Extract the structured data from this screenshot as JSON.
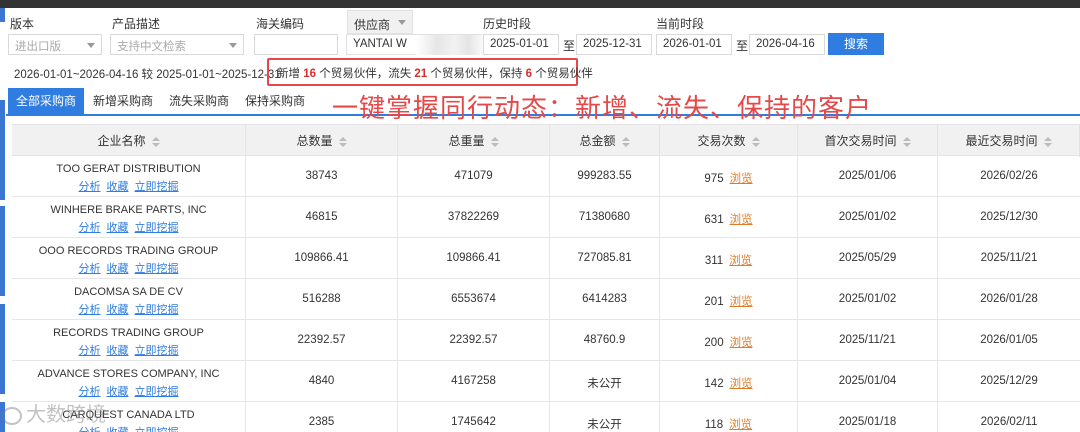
{
  "filters": {
    "version": {
      "label": "版本",
      "placeholder": "进出口版"
    },
    "product": {
      "label": "产品描述",
      "placeholder": "支持中文检索"
    },
    "hscode": {
      "label": "海关编码",
      "value": ""
    },
    "supplier": {
      "label": "供应商",
      "value": "YANTAI W"
    },
    "history": {
      "label": "历史时段",
      "start": "2025-01-01",
      "sep": "至",
      "end": "2025-12-31"
    },
    "current": {
      "label": "当前时段",
      "start": "2026-01-01",
      "sep": "至",
      "end": "2026-04-16"
    },
    "search_label": "搜索"
  },
  "summary": {
    "compare_text": "2026-01-01~2026-04-16 较 2025-01-01~2025-12-31",
    "new_prefix": "新增",
    "new_count": "16",
    "new_suffix": "个贸易伙伴，流失",
    "lost_count": "21",
    "lost_suffix": "个贸易伙伴，保持",
    "kept_count": "6",
    "kept_suffix": "个贸易伙伴"
  },
  "tabs": [
    "全部采购商",
    "新增采购商",
    "流失采购商",
    "保持采购商"
  ],
  "slogan": "一键掌握同行动态：新增、流失、保持的客户",
  "table": {
    "columns": [
      "企业名称",
      "总数量",
      "总重量",
      "总金额",
      "交易次数",
      "首次交易时间",
      "最近交易时间"
    ],
    "link_labels": {
      "analyze": "分析",
      "favorite": "收藏",
      "mine": "立即挖掘",
      "browse": "浏览"
    },
    "rows": [
      {
        "name": "TOO GERAT DISTRIBUTION",
        "qty": "38743",
        "weight": "471079",
        "amount": "999283.55",
        "trades": "975",
        "first": "2025/01/06",
        "last": "2026/02/26"
      },
      {
        "name": "WINHERE BRAKE PARTS, INC",
        "qty": "46815",
        "weight": "37822269",
        "amount": "71380680",
        "trades": "631",
        "first": "2025/01/02",
        "last": "2025/12/30"
      },
      {
        "name": "OOO RECORDS TRADING GROUP",
        "qty": "109866.41",
        "weight": "109866.41",
        "amount": "727085.81",
        "trades": "311",
        "first": "2025/05/29",
        "last": "2025/11/21"
      },
      {
        "name": "DACOMSA SA DE CV",
        "qty": "516288",
        "weight": "6553674",
        "amount": "6414283",
        "trades": "201",
        "first": "2025/01/02",
        "last": "2026/01/28"
      },
      {
        "name": "RECORDS TRADING GROUP",
        "qty": "22392.57",
        "weight": "22392.57",
        "amount": "48760.9",
        "trades": "200",
        "first": "2025/11/21",
        "last": "2026/01/05"
      },
      {
        "name": "ADVANCE STORES COMPANY, INC",
        "qty": "4840",
        "weight": "4167258",
        "amount": "未公开",
        "trades": "142",
        "first": "2025/01/04",
        "last": "2025/12/29"
      },
      {
        "name": "CARQUEST CANADA LTD",
        "qty": "2385",
        "weight": "1745642",
        "amount": "未公开",
        "trades": "118",
        "first": "2025/01/18",
        "last": "2026/02/11"
      }
    ]
  },
  "watermark": "大数跨境"
}
